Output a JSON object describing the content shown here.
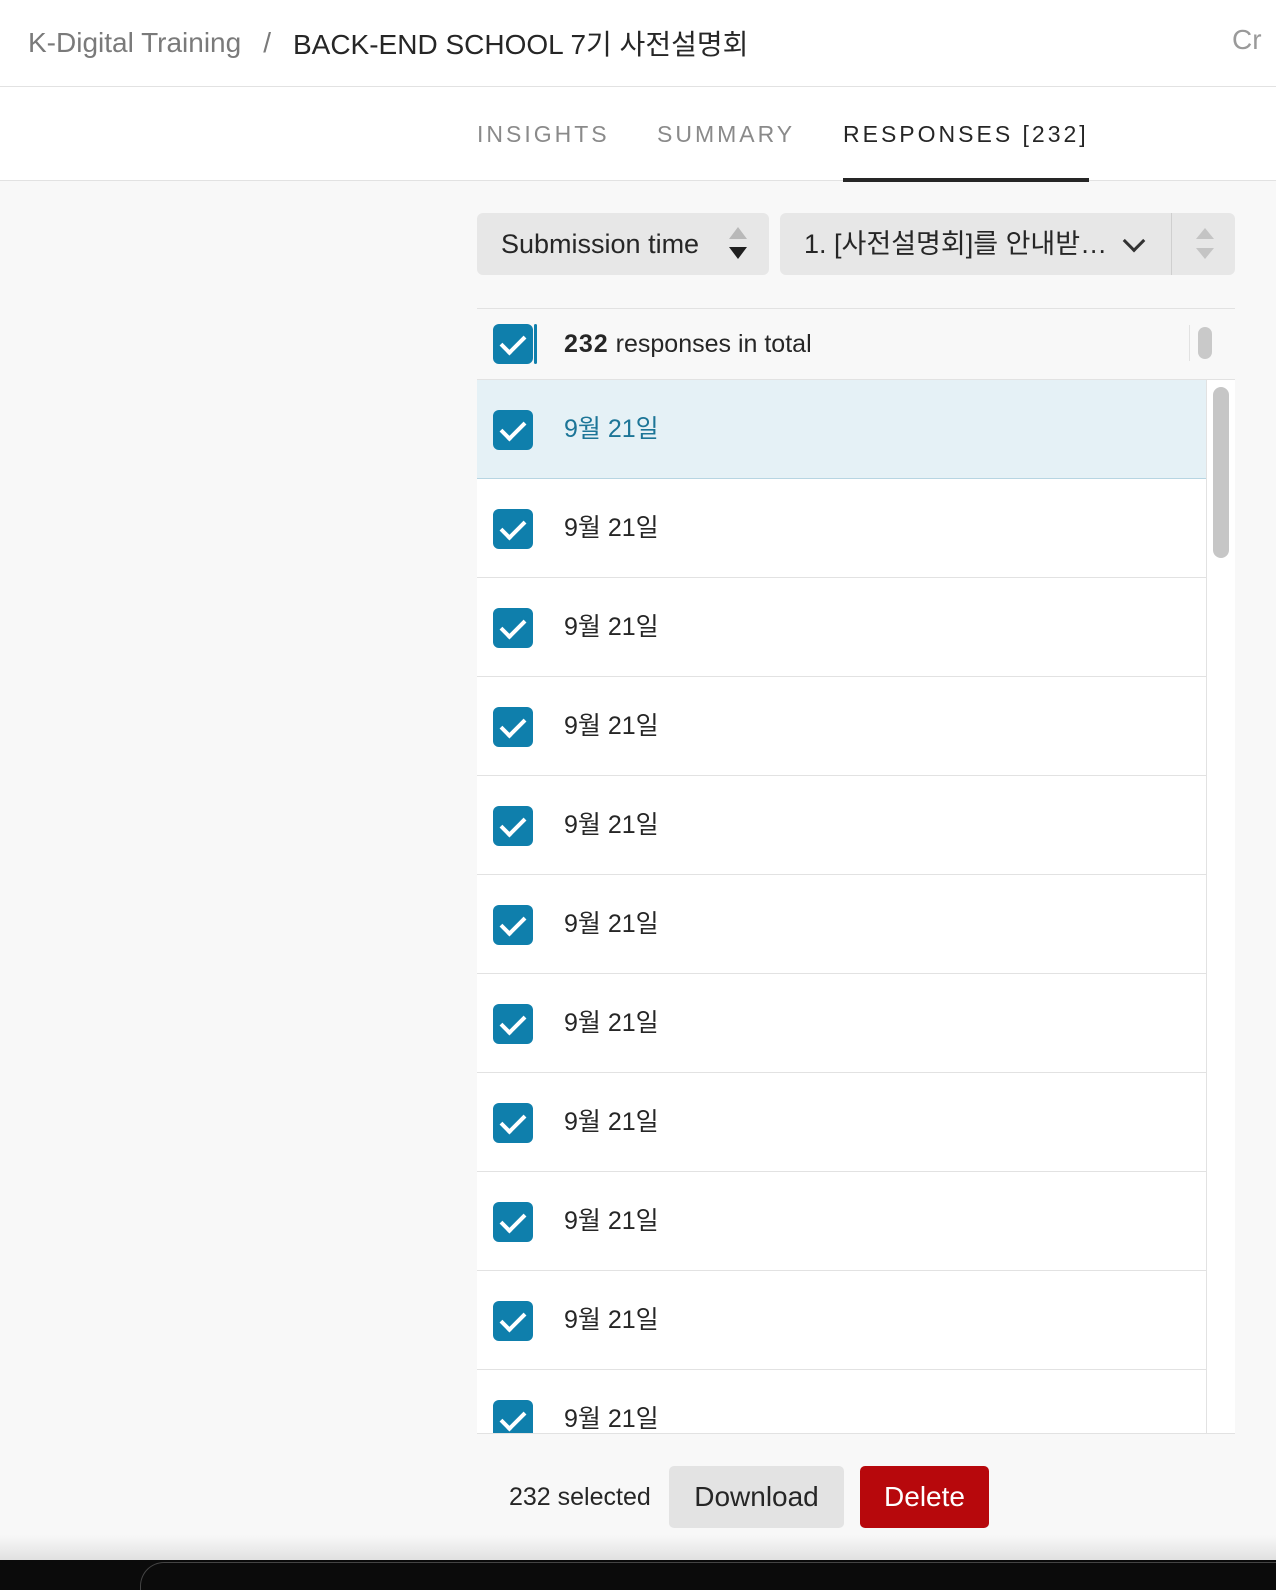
{
  "breadcrumb": {
    "workspace": "K-Digital Training",
    "separator": "/",
    "form_title": "BACK-END SCHOOL 7기 사전설명회",
    "right_partial": "Cr"
  },
  "tabs": [
    {
      "label": "INSIGHTS",
      "active": false
    },
    {
      "label": "SUMMARY",
      "active": false
    },
    {
      "label": "RESPONSES [232]",
      "active": true
    }
  ],
  "controls": {
    "sort_label": "Submission time",
    "question_select": "1. [사전설명회]를 안내받…"
  },
  "list": {
    "total_count": "232",
    "total_suffix": "responses in total",
    "all_checked": true,
    "rows": [
      {
        "date": "9월 21일",
        "checked": true,
        "highlighted": true
      },
      {
        "date": "9월 21일",
        "checked": true,
        "highlighted": false
      },
      {
        "date": "9월 21일",
        "checked": true,
        "highlighted": false
      },
      {
        "date": "9월 21일",
        "checked": true,
        "highlighted": false
      },
      {
        "date": "9월 21일",
        "checked": true,
        "highlighted": false
      },
      {
        "date": "9월 21일",
        "checked": true,
        "highlighted": false
      },
      {
        "date": "9월 21일",
        "checked": true,
        "highlighted": false
      },
      {
        "date": "9월 21일",
        "checked": true,
        "highlighted": false
      },
      {
        "date": "9월 21일",
        "checked": true,
        "highlighted": false
      },
      {
        "date": "9월 21일",
        "checked": true,
        "highlighted": false
      },
      {
        "date": "9월 21일",
        "checked": true,
        "highlighted": false
      }
    ]
  },
  "footer": {
    "selected_text": "232 selected",
    "download_label": "Download",
    "delete_label": "Delete"
  },
  "colors": {
    "accent": "#0f7fac",
    "selected_row_bg": "#e5f1f6",
    "selected_row_text": "#1c7597",
    "delete_red": "#b7080c",
    "button_gray": "#e3e3e3"
  },
  "icons": {
    "sort": "sort-arrows-icon",
    "dropdown": "chevron-down-icon",
    "checkbox": "check-icon"
  }
}
